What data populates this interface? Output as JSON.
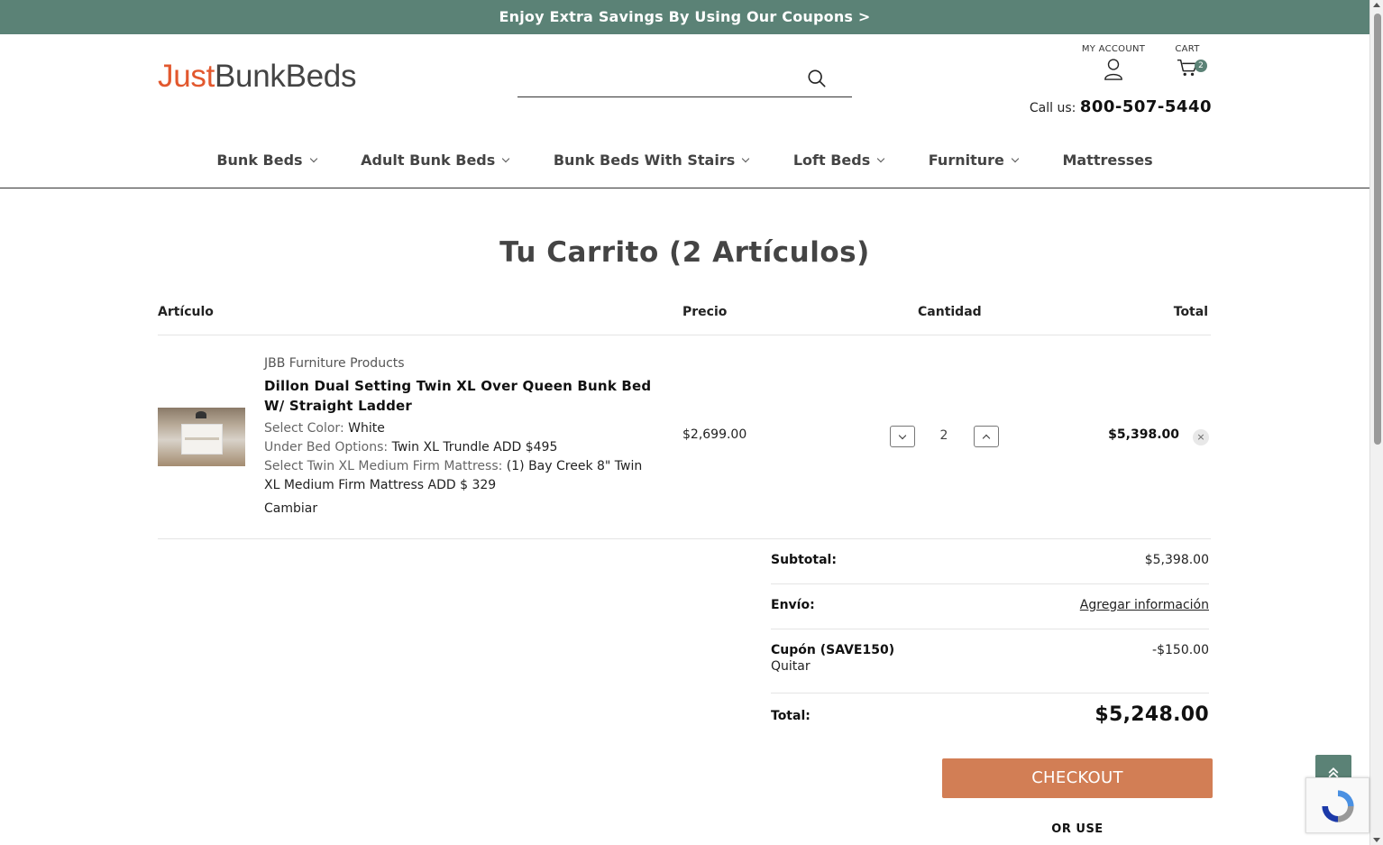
{
  "promo": {
    "text": "Enjoy Extra Savings By Using Our Coupons >"
  },
  "header": {
    "logo_part1": "Just",
    "logo_part2": "BunkBeds",
    "search_placeholder": "",
    "my_account_label": "MY ACCOUNT",
    "cart_label": "CART",
    "cart_count": "2",
    "call_label": "Call us:",
    "phone": "800-507-5440"
  },
  "nav": {
    "items": [
      {
        "label": "Bunk Beds"
      },
      {
        "label": "Adult Bunk Beds"
      },
      {
        "label": "Bunk Beds With Stairs"
      },
      {
        "label": "Loft Beds"
      },
      {
        "label": "Furniture"
      },
      {
        "label": "Mattresses"
      }
    ]
  },
  "cart": {
    "title": "Tu Carrito (2 Artículos)",
    "columns": {
      "item": "Artículo",
      "price": "Precio",
      "qty": "Cantidad",
      "total": "Total"
    },
    "items": [
      {
        "brand": "JBB Furniture Products",
        "name": "Dillon Dual Setting Twin XL Over Queen Bunk Bed W/ Straight Ladder",
        "options": [
          {
            "key": "Select Color:",
            "value": "White"
          },
          {
            "key": "Under Bed Options:",
            "value": "Twin XL Trundle ADD $495"
          },
          {
            "key": "Select Twin XL Medium Firm Mattress:",
            "value": "(1) Bay Creek 8\" Twin XL Medium Firm Mattress ADD $ 329"
          }
        ],
        "change_label": "Cambiar",
        "price": "$2,699.00",
        "quantity": "2",
        "line_total": "$5,398.00",
        "remove_glyph": "×"
      }
    ]
  },
  "summary": {
    "subtotal_label": "Subtotal:",
    "subtotal_value": "$5,398.00",
    "shipping_label": "Envío:",
    "shipping_value": "Agregar información",
    "coupon_label": "Cupón (SAVE150)",
    "coupon_remove": "Quitar",
    "coupon_value": "-$150.00",
    "total_label": "Total:",
    "total_value": "$5,248.00"
  },
  "actions": {
    "checkout_label": "CHECKOUT",
    "or_use_label": "OR USE"
  },
  "colors": {
    "brand_green": "#5b8276",
    "logo_orange": "#e2582e",
    "checkout_orange": "#d27e55"
  }
}
